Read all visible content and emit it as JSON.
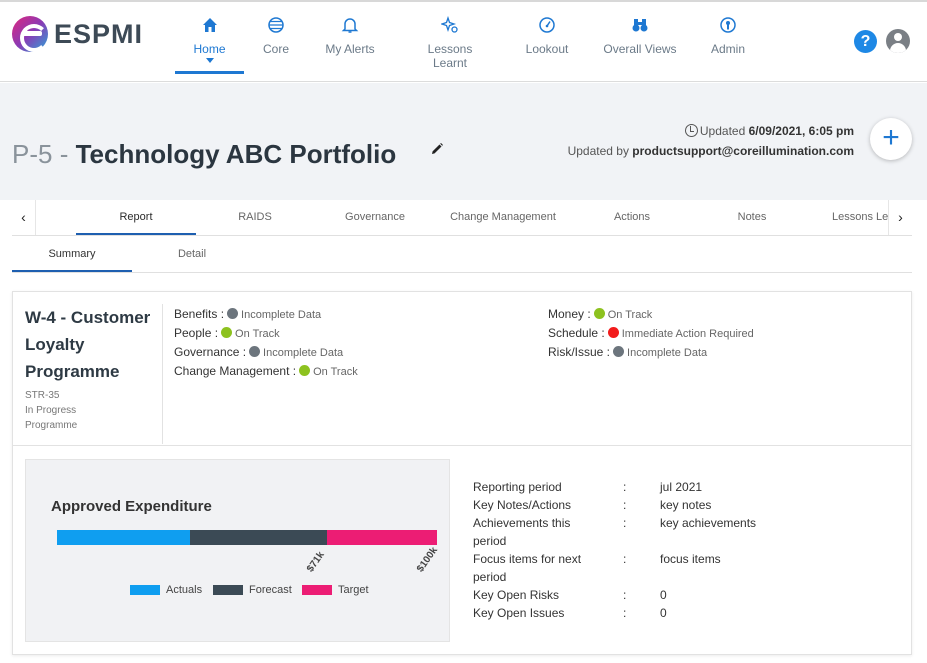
{
  "app": {
    "logo_text": "ESPMI"
  },
  "nav": {
    "items": [
      {
        "label": "Home",
        "icon": "home-icon"
      },
      {
        "label": "Core",
        "icon": "globe-icon"
      },
      {
        "label": "My Alerts",
        "icon": "bell-icon"
      },
      {
        "label": "Lessons Learnt",
        "icon": "sparkle-icon"
      },
      {
        "label": "Lookout",
        "icon": "gauge-icon"
      },
      {
        "label": "Overall Views",
        "icon": "binoculars-icon"
      },
      {
        "label": "Admin",
        "icon": "admin-icon"
      }
    ],
    "active": "Home",
    "help_label": "?"
  },
  "page": {
    "code": "P-5",
    "separator": " - ",
    "name": "Technology ABC Portfolio",
    "updated_prefix": "Updated ",
    "updated_date": "6/09/2021, 6:05 pm",
    "updated_by_prefix": "Updated by ",
    "updated_by": "productsupport@coreillumination.com",
    "add_label": "+"
  },
  "tabs": [
    "Report",
    "RAIDS",
    "Governance",
    "Change Management",
    "Actions",
    "Notes",
    "Lessons Le"
  ],
  "tabs_active": "Report",
  "subtabs": [
    "Summary",
    "Detail"
  ],
  "subtabs_active": "Summary",
  "card": {
    "title": "W-4 - Customer Loyalty Programme",
    "code": "STR-35",
    "status": "In Progress",
    "type": "Programme",
    "left_status": [
      {
        "label": "Benefits :",
        "value": "Incomplete Data",
        "color": "#6c757d"
      },
      {
        "label": "People :",
        "value": "On Track",
        "color": "#8dc21f"
      },
      {
        "label": "Governance :",
        "value": "Incomplete Data",
        "color": "#6c757d"
      },
      {
        "label": "Change Management :",
        "value": "On Track",
        "color": "#8dc21f"
      }
    ],
    "right_status": [
      {
        "label": "Money :",
        "value": "On Track",
        "color": "#8dc21f"
      },
      {
        "label": "Schedule :",
        "value": "Immediate Action Required",
        "color": "#f21b1b"
      },
      {
        "label": "Risk/Issue :",
        "value": "Incomplete Data",
        "color": "#6c757d"
      }
    ]
  },
  "chart_data": {
    "type": "bar",
    "title": "Approved Expenditure",
    "orientation": "horizontal-stacked-segments",
    "series": [
      {
        "name": "Actuals",
        "start": 0,
        "end": 35,
        "color": "#0f9ef0"
      },
      {
        "name": "Forecast",
        "start": 35,
        "end": 71,
        "color": "#3b4a55"
      },
      {
        "name": "Target",
        "start": 71,
        "end": 100,
        "color": "#ec1d74"
      }
    ],
    "ticks": [
      {
        "value": 71,
        "label": "$71k"
      },
      {
        "value": 100,
        "label": "$100k"
      }
    ],
    "xlim": [
      0,
      100
    ],
    "legend_placement": "bottom"
  },
  "info": [
    {
      "key": "Reporting period",
      "colon": ":",
      "value": "jul 2021"
    },
    {
      "key": "Key Notes/Actions",
      "colon": ":",
      "value": "key notes"
    },
    {
      "key": "Achievements this period",
      "colon": ":",
      "value": "key achievements"
    },
    {
      "key": "Focus items for next period",
      "colon": ":",
      "value": "focus items"
    },
    {
      "key": "Key Open Risks",
      "colon": ":",
      "value": "0"
    },
    {
      "key": "Key Open Issues",
      "colon": ":",
      "value": "0"
    }
  ]
}
